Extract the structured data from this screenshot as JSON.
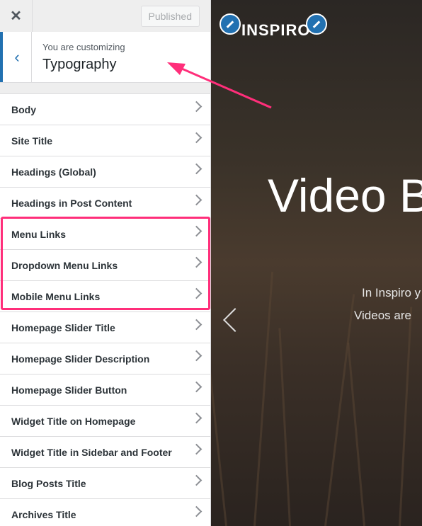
{
  "header": {
    "close_label": "✕",
    "publish_label": "Published"
  },
  "section": {
    "customizing_label": "You are customizing",
    "name": "Typography"
  },
  "items": [
    {
      "label": "Body"
    },
    {
      "label": "Site Title"
    },
    {
      "label": "Headings (Global)"
    },
    {
      "label": "Headings in Post Content"
    },
    {
      "label": "Menu Links"
    },
    {
      "label": "Dropdown Menu Links"
    },
    {
      "label": "Mobile Menu Links"
    },
    {
      "label": "Homepage Slider Title"
    },
    {
      "label": "Homepage Slider Description"
    },
    {
      "label": "Homepage Slider Button"
    },
    {
      "label": "Widget Title on Homepage"
    },
    {
      "label": "Widget Title in Sidebar and Footer"
    },
    {
      "label": "Blog Posts Title"
    },
    {
      "label": "Archives Title"
    }
  ],
  "preview": {
    "logo": "INSPIRO",
    "hero_title": "Video B",
    "hero_line1": "In Inspiro y",
    "hero_line2": "Videos are"
  },
  "colors": {
    "accent": "#2271b1",
    "highlight": "#ff2e7a"
  },
  "icons": {
    "close": "close-icon",
    "back": "chevron-left-icon",
    "item": "chevron-right-icon",
    "edit": "pencil-icon"
  }
}
